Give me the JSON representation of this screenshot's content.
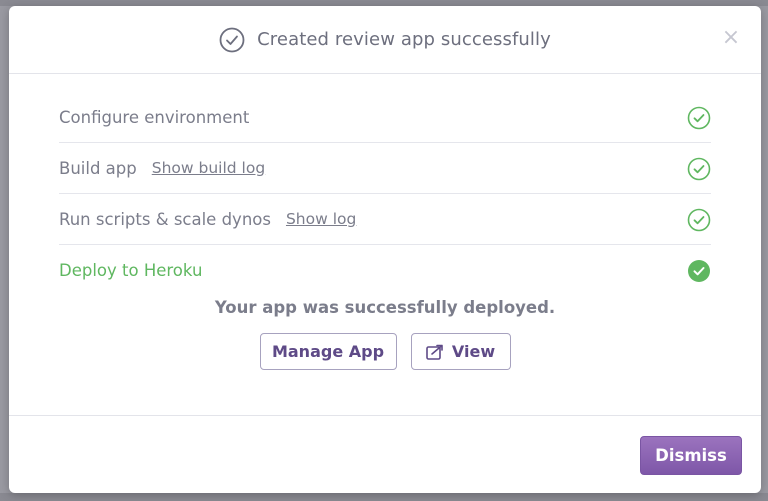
{
  "modal": {
    "title": "Created review app successfully",
    "close_icon": "close-icon",
    "close_glyph": "×"
  },
  "steps": [
    {
      "label": "Configure environment",
      "link": "",
      "status": "complete"
    },
    {
      "label": "Build app",
      "link": "Show build log",
      "status": "complete"
    },
    {
      "label": "Run scripts & scale dynos",
      "link": "Show log",
      "status": "complete"
    },
    {
      "label": "Deploy to Heroku",
      "link": "",
      "status": "success"
    }
  ],
  "deploy": {
    "message": "Your app was successfully deployed.",
    "manage_label": "Manage App",
    "view_label": "View"
  },
  "footer": {
    "dismiss_label": "Dismiss"
  },
  "colors": {
    "success_green": "#5fb760",
    "accent_purple": "#7e57a8",
    "muted_text": "#7b7d8b"
  }
}
